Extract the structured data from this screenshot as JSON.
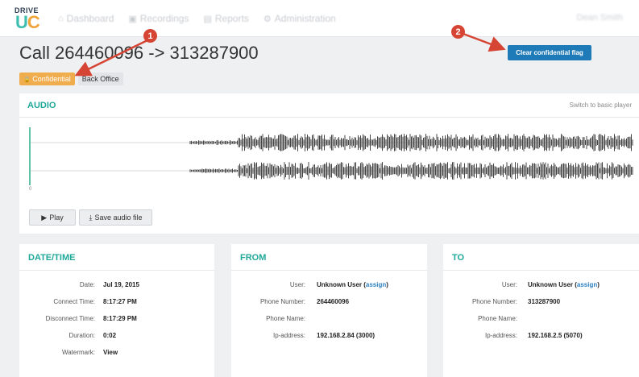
{
  "logo": {
    "word": "DRIVE",
    "mark_u": "U",
    "mark_c": "C"
  },
  "nav": {
    "items": [
      {
        "icon": "dashboard-icon",
        "glyph": "⌂",
        "label": "Dashboard"
      },
      {
        "icon": "recordings-icon",
        "glyph": "▣",
        "label": "Recordings"
      },
      {
        "icon": "reports-icon",
        "glyph": "▤",
        "label": "Reports"
      },
      {
        "icon": "administration-icon",
        "glyph": "⚙",
        "label": "Administration"
      }
    ],
    "user": "Dean Smith"
  },
  "header": {
    "title": "Call 264460096 -> 313287900",
    "badge_confidential": "Confidential",
    "badge_lock_glyph": "🔒",
    "badge_backoffice": "Back Office",
    "clear_button": "Clear confidential flag"
  },
  "audio": {
    "title": "AUDIO",
    "switch_link": "Switch to basic player",
    "tick_start": "0",
    "play_label": "Play",
    "play_glyph": "▶",
    "save_label": "Save audio file",
    "save_glyph": "⤓"
  },
  "datetime": {
    "title": "DATE/TIME",
    "rows": [
      {
        "label": "Date:",
        "value": "Jul 19, 2015"
      },
      {
        "label": "Connect Time:",
        "value": "8:17:27 PM"
      },
      {
        "label": "Disconnect Time:",
        "value": "8:17:29 PM"
      },
      {
        "label": "Duration:",
        "value": "0:02"
      },
      {
        "label": "Watermark:",
        "value": "View"
      }
    ]
  },
  "from": {
    "title": "FROM",
    "user_label": "User:",
    "user_value": "Unknown User",
    "assign": "assign",
    "rows": [
      {
        "label": "Phone Number:",
        "value": "264460096"
      },
      {
        "label": "Phone Name:",
        "value": ""
      },
      {
        "label": "Ip-address:",
        "value": "192.168.2.84 (3000)"
      }
    ]
  },
  "to": {
    "title": "TO",
    "user_label": "User:",
    "user_value": "Unknown User",
    "assign": "assign",
    "rows": [
      {
        "label": "Phone Number:",
        "value": "313287900"
      },
      {
        "label": "Phone Name:",
        "value": ""
      },
      {
        "label": "Ip-address:",
        "value": "192.168.2.5 (5070)"
      }
    ]
  },
  "annotations": {
    "one": "1",
    "two": "2"
  },
  "colors": {
    "accent": "#1fa899",
    "primary_button": "#1f7ab8",
    "warning": "#f0ad4e",
    "annotation": "#d64533"
  }
}
